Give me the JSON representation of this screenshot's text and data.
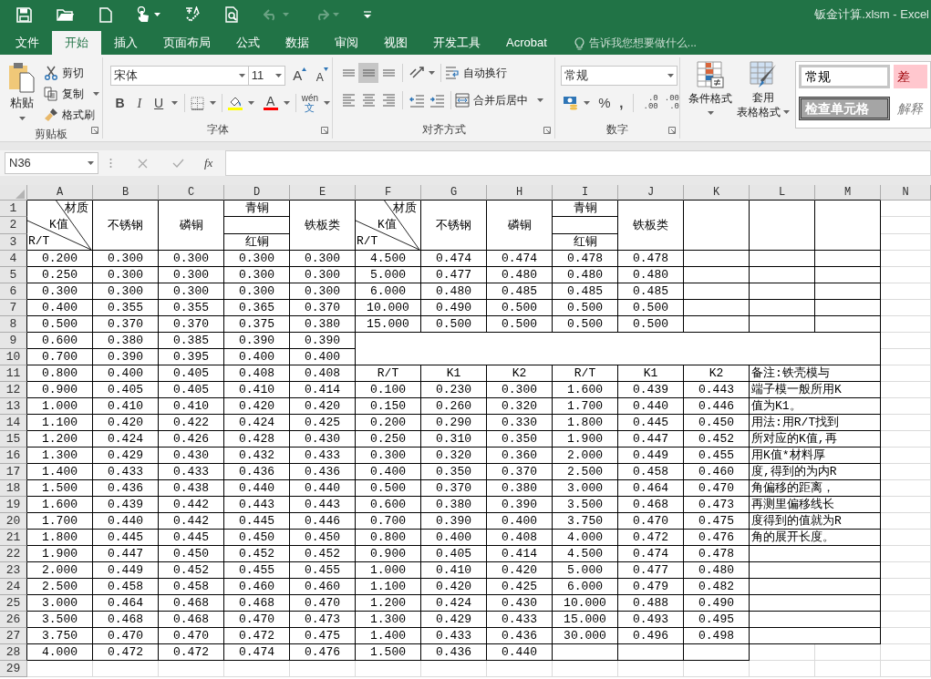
{
  "quick_access": {
    "undo": {
      "disabled": true
    },
    "redo": {
      "disabled": true
    }
  },
  "window": {
    "title": "钣金计算.xlsm - Excel"
  },
  "tabs": [
    {
      "label": "文件",
      "selected": false
    },
    {
      "label": "开始",
      "selected": true
    },
    {
      "label": "插入",
      "selected": false
    },
    {
      "label": "页面布局",
      "selected": false
    },
    {
      "label": "公式",
      "selected": false
    },
    {
      "label": "数据",
      "selected": false
    },
    {
      "label": "审阅",
      "selected": false
    },
    {
      "label": "视图",
      "selected": false
    },
    {
      "label": "开发工具",
      "selected": false
    },
    {
      "label": "Acrobat",
      "selected": false
    }
  ],
  "tell_me": {
    "placeholder": "告诉我您想要做什么..."
  },
  "ribbon": {
    "clipboard": {
      "label": "剪贴板",
      "paste": "粘贴",
      "cut": "剪切",
      "copy": "复制",
      "format_painter": "格式刷"
    },
    "font": {
      "label": "字体",
      "font_name": "宋体",
      "font_size": "11",
      "grow": "A",
      "shrink": "A",
      "bold": "B",
      "italic": "I",
      "underline": "U",
      "font_color": "A",
      "phonetic_top": "wén",
      "phonetic_bottom": "文"
    },
    "alignment": {
      "label": "对齐方式",
      "middle_align_selected": true,
      "wrap_text": "自动换行",
      "merge_center": "合并后居中"
    },
    "number": {
      "label": "数字",
      "format": "常规",
      "percent": "%",
      "comma": ",",
      "increase_decimal": [
        ".0",
        ".00"
      ],
      "decrease_decimal": [
        ".00",
        ".0"
      ]
    },
    "styles": {
      "conditional_formatting": "条件格式",
      "format_as_table": [
        "套用",
        "表格格式"
      ],
      "cell_styles": [
        {
          "label": "常规",
          "kind": "normal"
        },
        {
          "label": "差",
          "kind": "bad"
        },
        {
          "label": "检查单元格",
          "kind": "check"
        },
        {
          "label": "解释",
          "kind": "explanatory"
        }
      ]
    }
  },
  "formula_bar": {
    "name_box": "N36",
    "fx": "fx"
  },
  "sheet": {
    "columns": [
      "A",
      "B",
      "C",
      "D",
      "E",
      "F",
      "G",
      "H",
      "I",
      "J",
      "K",
      "L",
      "M",
      "N"
    ],
    "rows": [
      "1",
      "2",
      "3",
      "4",
      "5",
      "6",
      "7",
      "8",
      "9",
      "10",
      "11",
      "12",
      "13",
      "14",
      "15",
      "16",
      "17",
      "18",
      "19",
      "20",
      "21",
      "22",
      "23",
      "24",
      "25",
      "26",
      "27",
      "28",
      "29"
    ],
    "table_1": {
      "corner": {
        "top": "材质",
        "middle": "K值",
        "bottom": "R/T"
      },
      "materials": [
        {
          "kind": "single",
          "label": "不锈钢"
        },
        {
          "kind": "single",
          "label": "磷铜"
        },
        {
          "kind": "split",
          "top": "青铜",
          "bottom": "红铜"
        },
        {
          "kind": "single",
          "label": "铁板类"
        }
      ],
      "rows": [
        [
          "0.200",
          "0.300",
          "0.300",
          "0.300",
          "0.300"
        ],
        [
          "0.250",
          "0.300",
          "0.300",
          "0.300",
          "0.300"
        ],
        [
          "0.300",
          "0.300",
          "0.300",
          "0.300",
          "0.300"
        ],
        [
          "0.400",
          "0.355",
          "0.355",
          "0.365",
          "0.370"
        ],
        [
          "0.500",
          "0.370",
          "0.370",
          "0.375",
          "0.380"
        ],
        [
          "0.600",
          "0.380",
          "0.385",
          "0.390",
          "0.390"
        ],
        [
          "0.700",
          "0.390",
          "0.395",
          "0.400",
          "0.400"
        ],
        [
          "0.800",
          "0.400",
          "0.405",
          "0.408",
          "0.408"
        ],
        [
          "0.900",
          "0.405",
          "0.405",
          "0.410",
          "0.414"
        ],
        [
          "1.000",
          "0.410",
          "0.410",
          "0.420",
          "0.420"
        ],
        [
          "1.100",
          "0.420",
          "0.422",
          "0.424",
          "0.425"
        ],
        [
          "1.200",
          "0.424",
          "0.426",
          "0.428",
          "0.430"
        ],
        [
          "1.300",
          "0.429",
          "0.430",
          "0.432",
          "0.433"
        ],
        [
          "1.400",
          "0.433",
          "0.433",
          "0.436",
          "0.436"
        ],
        [
          "1.500",
          "0.436",
          "0.438",
          "0.440",
          "0.440"
        ],
        [
          "1.600",
          "0.439",
          "0.442",
          "0.443",
          "0.443"
        ],
        [
          "1.700",
          "0.440",
          "0.442",
          "0.445",
          "0.446"
        ],
        [
          "1.800",
          "0.445",
          "0.445",
          "0.450",
          "0.450"
        ],
        [
          "1.900",
          "0.447",
          "0.450",
          "0.452",
          "0.452"
        ],
        [
          "2.000",
          "0.449",
          "0.452",
          "0.455",
          "0.455"
        ],
        [
          "2.500",
          "0.458",
          "0.458",
          "0.460",
          "0.460"
        ],
        [
          "3.000",
          "0.464",
          "0.468",
          "0.468",
          "0.470"
        ],
        [
          "3.500",
          "0.468",
          "0.468",
          "0.470",
          "0.473"
        ],
        [
          "3.750",
          "0.470",
          "0.470",
          "0.472",
          "0.475"
        ],
        [
          "4.000",
          "0.472",
          "0.472",
          "0.474",
          "0.476"
        ]
      ]
    },
    "table_2": {
      "corner": {
        "top": "材质",
        "middle": "K值",
        "bottom": "R/T"
      },
      "materials": [
        {
          "kind": "single",
          "label": "不锈钢"
        },
        {
          "kind": "single",
          "label": "磷铜"
        },
        {
          "kind": "split",
          "top": "青铜",
          "bottom": "红铜"
        },
        {
          "kind": "single",
          "label": "铁板类"
        }
      ],
      "rows": [
        [
          "4.500",
          "0.474",
          "0.474",
          "0.478",
          "0.478"
        ],
        [
          "5.000",
          "0.477",
          "0.480",
          "0.480",
          "0.480"
        ],
        [
          "6.000",
          "0.480",
          "0.485",
          "0.485",
          "0.485"
        ],
        [
          "10.000",
          "0.490",
          "0.500",
          "0.500",
          "0.500"
        ],
        [
          "15.000",
          "0.500",
          "0.500",
          "0.500",
          "0.500"
        ]
      ]
    },
    "table_3": {
      "header": [
        "R/T",
        "K1",
        "K2",
        "R/T",
        "K1",
        "K2"
      ],
      "rows": [
        [
          "0.100",
          "0.230",
          "0.300",
          "1.600",
          "0.439",
          "0.443"
        ],
        [
          "0.150",
          "0.260",
          "0.320",
          "1.700",
          "0.440",
          "0.446"
        ],
        [
          "0.200",
          "0.290",
          "0.330",
          "1.800",
          "0.445",
          "0.450"
        ],
        [
          "0.250",
          "0.310",
          "0.350",
          "1.900",
          "0.447",
          "0.452"
        ],
        [
          "0.300",
          "0.320",
          "0.360",
          "2.000",
          "0.449",
          "0.455"
        ],
        [
          "0.400",
          "0.350",
          "0.370",
          "2.500",
          "0.458",
          "0.460"
        ],
        [
          "0.500",
          "0.370",
          "0.380",
          "3.000",
          "0.464",
          "0.470"
        ],
        [
          "0.600",
          "0.380",
          "0.390",
          "3.500",
          "0.468",
          "0.473"
        ],
        [
          "0.700",
          "0.390",
          "0.400",
          "3.750",
          "0.470",
          "0.475"
        ],
        [
          "0.800",
          "0.400",
          "0.408",
          "4.000",
          "0.472",
          "0.476"
        ],
        [
          "0.900",
          "0.405",
          "0.414",
          "4.500",
          "0.474",
          "0.478"
        ],
        [
          "1.000",
          "0.410",
          "0.420",
          "5.000",
          "0.477",
          "0.480"
        ],
        [
          "1.100",
          "0.420",
          "0.425",
          "6.000",
          "0.479",
          "0.482"
        ],
        [
          "1.200",
          "0.424",
          "0.430",
          "10.000",
          "0.488",
          "0.490"
        ],
        [
          "1.300",
          "0.429",
          "0.433",
          "15.000",
          "0.493",
          "0.495"
        ],
        [
          "1.400",
          "0.433",
          "0.436",
          "30.000",
          "0.496",
          "0.498"
        ],
        [
          "1.500",
          "0.436",
          "0.440"
        ]
      ]
    },
    "note": {
      "lines": [
        "备注:铁壳模与",
        "端子模一般所用K",
        "值为K1。",
        "用法:用R/T找到",
        "所对应的K值,再",
        "用K值*材料厚",
        "度,得到的为内R",
        "角偏移的距离，",
        "再测里偏移线长",
        "度得到的值就为R",
        "角的展开长度。"
      ]
    }
  }
}
